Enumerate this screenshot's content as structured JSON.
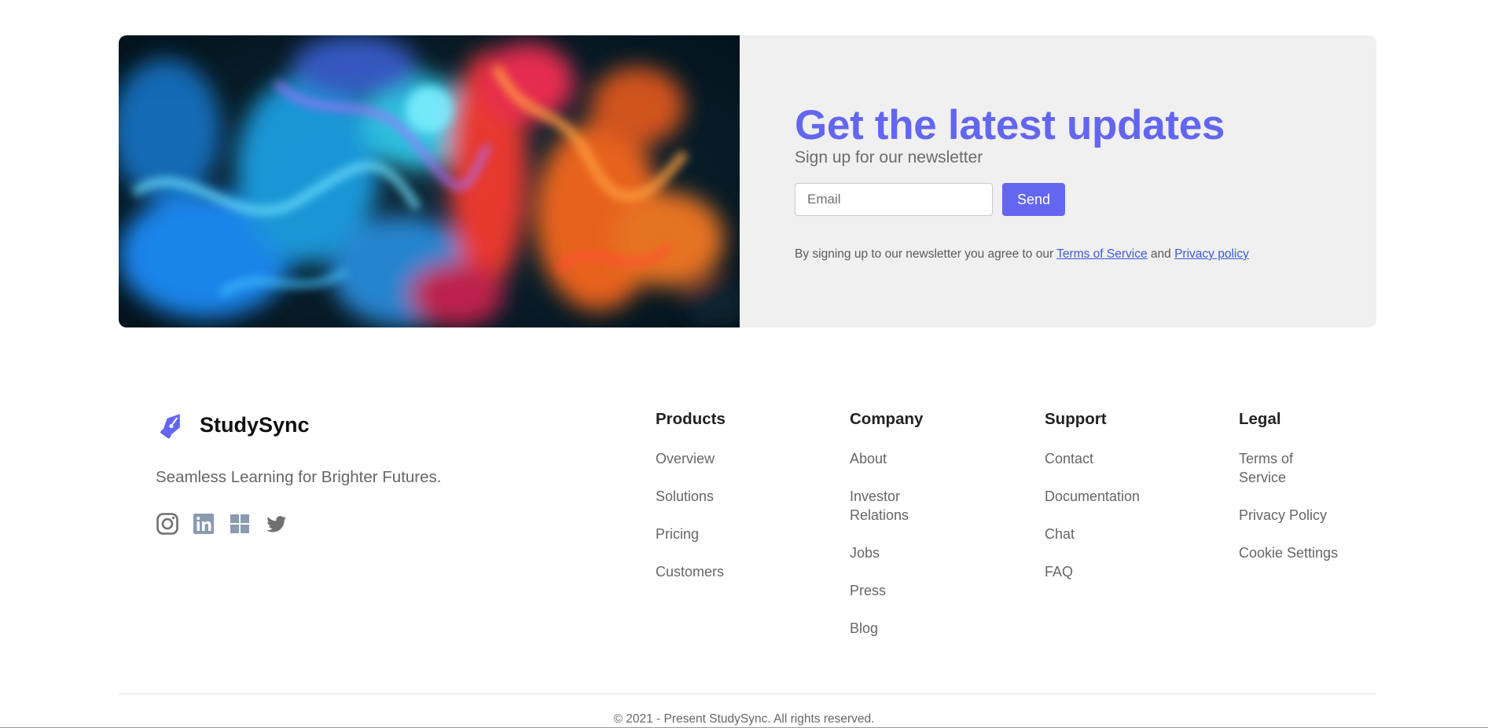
{
  "newsletter": {
    "image_name": "colorful-ink-smoke-image",
    "headline": "Get the latest updates",
    "subheadline": "Sign up for our newsletter",
    "email_placeholder": "Email",
    "send_label": "Send",
    "terms_prefix": "By signing up to our newsletter you agree to our",
    "terms_link": "Terms of Service",
    "terms_and": "and",
    "privacy_link": "Privacy policy"
  },
  "brand": {
    "name": "StudySync",
    "tagline": "Seamless Learning for Brighter Futures.",
    "logo_icon": "pen-nib-icon"
  },
  "socials": [
    {
      "name": "instagram-icon"
    },
    {
      "name": "linkedin-icon"
    },
    {
      "name": "windows-icon"
    },
    {
      "name": "twitter-icon"
    }
  ],
  "columns": {
    "products": {
      "title": "Products",
      "links": [
        "Overview",
        "Solutions",
        "Pricing",
        "Customers"
      ]
    },
    "company": {
      "title": "Company",
      "links": [
        "About",
        "Investor Relations",
        "Jobs",
        "Press",
        "Blog"
      ]
    },
    "support": {
      "title": "Support",
      "links": [
        "Contact",
        "Documentation",
        "Chat",
        "FAQ"
      ]
    },
    "legal": {
      "title": "Legal",
      "links": [
        "Terms of Service",
        "Privacy Policy",
        "Cookie Settings"
      ]
    }
  },
  "copyright": "© 2021 - Present StudySync. All rights reserved.",
  "colors": {
    "accent": "#6366f1",
    "banner_bg": "#f0f0f0",
    "link": "#3b5bdb"
  }
}
